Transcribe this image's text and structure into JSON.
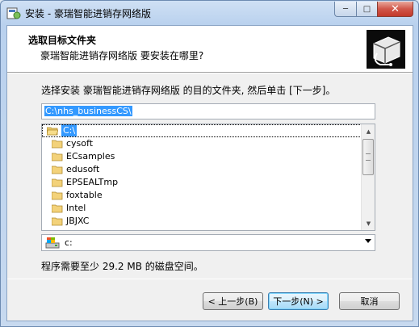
{
  "window": {
    "title": "安装 - 豪瑞智能进销存网络版",
    "buttons": {
      "minimize": "minimize",
      "maximize": "maximize",
      "close": "close"
    }
  },
  "header": {
    "title": "选取目标文件夹",
    "subtitle": "豪瑞智能进销存网络版 要安装在哪里?"
  },
  "instruction": "选择安装 豪瑞智能进销存网络版 的目的文件夹, 然后单击 [下一步]。",
  "path_input": {
    "value": "C:\\nhs_businessCS\\"
  },
  "folder_tree": {
    "root": "C:\\",
    "items": [
      "cysoft",
      "ECsamples",
      "edusoft",
      "EPSEALTmp",
      "foxtable",
      "Intel",
      "JBJXC"
    ]
  },
  "drive_select": {
    "value": "c:"
  },
  "space_required": "程序需要至少 29.2 MB 的磁盘空间。",
  "buttons": {
    "back": "< 上一步(B)",
    "next": "下一步(N) >",
    "cancel": "取消"
  },
  "colors": {
    "selection": "#3399ff",
    "close_button": "#c3392b"
  }
}
